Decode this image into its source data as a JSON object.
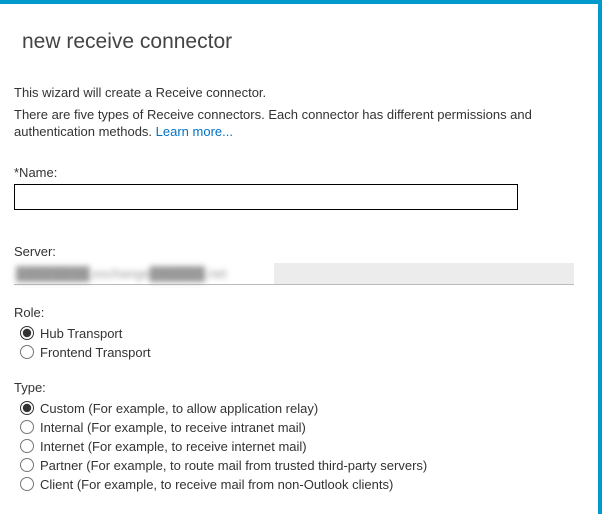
{
  "title": "new receive connector",
  "intro_line1": "This wizard will create a Receive connector.",
  "intro_line2": "There are five types of Receive connectors. Each connector has different permissions and authentication methods. ",
  "learn_more": "Learn more...",
  "fields": {
    "name_label": "*Name:",
    "name_value": "",
    "server_label": "Server:",
    "server_value": "████████.exchange██████.net"
  },
  "role": {
    "label": "Role:",
    "options": [
      {
        "label": "Hub Transport",
        "selected": true
      },
      {
        "label": "Frontend Transport",
        "selected": false
      }
    ]
  },
  "type": {
    "label": "Type:",
    "options": [
      {
        "label": "Custom (For example, to allow application relay)",
        "selected": true
      },
      {
        "label": "Internal (For example, to receive intranet mail)",
        "selected": false
      },
      {
        "label": "Internet (For example, to receive internet mail)",
        "selected": false
      },
      {
        "label": "Partner (For example, to route mail from trusted third-party servers)",
        "selected": false
      },
      {
        "label": "Client (For example, to receive mail from non-Outlook clients)",
        "selected": false
      }
    ]
  }
}
